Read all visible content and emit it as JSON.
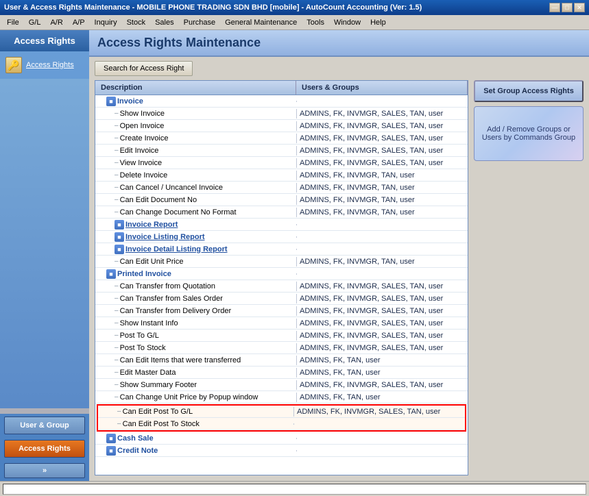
{
  "titleBar": {
    "text": "User & Access Rights Maintenance - MOBILE PHONE TRADING SDN  BHD [mobile] - AutoCount Accounting (Ver: 1.5)",
    "buttons": [
      "—",
      "□",
      "✕"
    ]
  },
  "menuBar": {
    "items": [
      "File",
      "G/L",
      "A/R",
      "A/P",
      "Inquiry",
      "Stock",
      "Sales",
      "Purchase",
      "General Maintenance",
      "Tools",
      "Window",
      "Help"
    ]
  },
  "sidebar": {
    "title": "Access Rights",
    "link": "Access Rights",
    "buttons": [
      "User & Group",
      "Access Rights",
      "»"
    ]
  },
  "content": {
    "title": "Access Rights Maintenance",
    "searchBtn": "Search for Access Right",
    "table": {
      "columns": [
        "Description",
        "Users & Groups"
      ],
      "rows": [
        {
          "type": "section",
          "label": "Invoice",
          "users": ""
        },
        {
          "type": "row",
          "label": "Show Invoice",
          "users": "ADMINS, FK, INVMGR, SALES, TAN, user"
        },
        {
          "type": "row",
          "label": "Open Invoice",
          "users": "ADMINS, FK, INVMGR, SALES, TAN, user"
        },
        {
          "type": "row",
          "label": "Create Invoice",
          "users": "ADMINS, FK, INVMGR, SALES, TAN, user"
        },
        {
          "type": "row",
          "label": "Edit Invoice",
          "users": "ADMINS, FK, INVMGR, SALES, TAN, user"
        },
        {
          "type": "row",
          "label": "View Invoice",
          "users": "ADMINS, FK, INVMGR, SALES, TAN, user"
        },
        {
          "type": "row",
          "label": "Delete Invoice",
          "users": "ADMINS, FK, INVMGR, TAN, user"
        },
        {
          "type": "row",
          "label": "Can Cancel / Uncancel Invoice",
          "users": "ADMINS, FK, INVMGR, TAN, user"
        },
        {
          "type": "row",
          "label": "Can Edit Document No",
          "users": "ADMINS, FK, INVMGR, TAN, user"
        },
        {
          "type": "row",
          "label": "Can Change Document No Format",
          "users": "ADMINS, FK, INVMGR, TAN, user"
        },
        {
          "type": "subsection",
          "label": "Invoice Report",
          "users": ""
        },
        {
          "type": "subsection",
          "label": "Invoice Listing Report",
          "users": ""
        },
        {
          "type": "subsection",
          "label": "Invoice Detail Listing Report",
          "users": ""
        },
        {
          "type": "row",
          "label": "Can Edit Unit Price",
          "users": "ADMINS, FK, INVMGR, TAN, user"
        },
        {
          "type": "section",
          "label": "Printed Invoice",
          "users": ""
        },
        {
          "type": "row",
          "label": "Can Transfer from Quotation",
          "users": "ADMINS, FK, INVMGR, SALES, TAN, user"
        },
        {
          "type": "row",
          "label": "Can Transfer from Sales Order",
          "users": "ADMINS, FK, INVMGR, SALES, TAN, user"
        },
        {
          "type": "row",
          "label": "Can Transfer from Delivery Order",
          "users": "ADMINS, FK, INVMGR, SALES, TAN, user"
        },
        {
          "type": "row",
          "label": "Show Instant Info",
          "users": "ADMINS, FK, INVMGR, SALES, TAN, user"
        },
        {
          "type": "row",
          "label": "Post To G/L",
          "users": "ADMINS, FK, INVMGR, SALES, TAN, user"
        },
        {
          "type": "row",
          "label": "Post To Stock",
          "users": "ADMINS, FK, INVMGR, SALES, TAN, user"
        },
        {
          "type": "row",
          "label": "Can Edit Items that were transferred",
          "users": "ADMINS, FK, TAN, user"
        },
        {
          "type": "row",
          "label": "Edit Master Data",
          "users": "ADMINS, FK, TAN, user"
        },
        {
          "type": "row",
          "label": "Show Summary Footer",
          "users": "ADMINS, FK, INVMGR, SALES, TAN, user"
        },
        {
          "type": "row",
          "label": "Can Change Unit Price by Popup window",
          "users": "ADMINS, FK, TAN, user"
        },
        {
          "type": "row-highlight",
          "label": "Can Edit Post To G/L",
          "users": "ADMINS, FK, INVMGR, SALES, TAN, user"
        },
        {
          "type": "row-highlight",
          "label": "Can Edit Post To Stock",
          "users": ""
        },
        {
          "type": "section",
          "label": "Cash Sale",
          "users": ""
        },
        {
          "type": "section",
          "label": "Credit Note",
          "users": ""
        }
      ]
    }
  },
  "rightPanel": {
    "setGroupBtn": "Set Group Access Rights",
    "cardText": "Add / Remove Groups or Users by Commands Group"
  },
  "icons": {
    "sectionIcon": "■",
    "dash": "–"
  }
}
